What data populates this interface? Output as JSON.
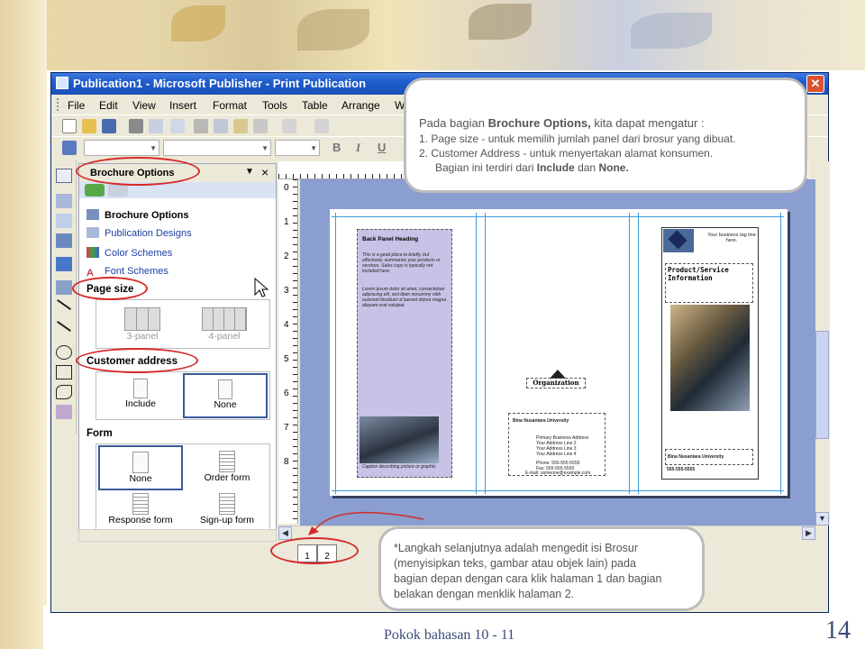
{
  "slide": {
    "footer_text": "Pokok bahasan 10 - 11",
    "page_number": "14"
  },
  "window": {
    "title": "Publication1 - Microsoft Publisher - Print Publication",
    "close_glyph": "✕"
  },
  "menu": {
    "items": [
      "File",
      "Edit",
      "View",
      "Insert",
      "Format",
      "Tools",
      "Table",
      "Arrange",
      "W"
    ]
  },
  "format_toolbar": {
    "bold": "B",
    "italic": "I",
    "underline": "U"
  },
  "task_pane": {
    "title": "Brochure Options",
    "links": [
      {
        "label": "Brochure Options",
        "icon": "brochure-icon"
      },
      {
        "label": "Publication Designs",
        "icon": "designs-icon"
      },
      {
        "label": "Color Schemes",
        "icon": "color-schemes-icon"
      },
      {
        "label": "Font Schemes",
        "icon": "font-schemes-icon"
      }
    ],
    "sections": {
      "page_size": {
        "heading": "Page size",
        "options": [
          "3-panel",
          "4-panel"
        ]
      },
      "customer_address": {
        "heading": "Customer address",
        "options": [
          "Include",
          "None"
        ],
        "selected": "None"
      },
      "form": {
        "heading": "Form",
        "options": [
          "None",
          "Order form",
          "Response form",
          "Sign-up form"
        ],
        "selected": "None"
      }
    }
  },
  "rulers": {
    "vertical_numbers": [
      "0",
      "1",
      "2",
      "3",
      "4",
      "5",
      "6",
      "7",
      "8"
    ]
  },
  "brochure": {
    "back_panel_heading": "Back Panel Heading",
    "back_panel_text": "This is a good place to briefly, but effectively, summarize your products or services. Sales copy is typically not included here.",
    "back_panel_text2": "Lorem ipsum dolor sit amet, consectetuer adipiscing elit, sed diam nonummy nibh euismod tincidunt ut laoreet dolore magna aliquam erat volutpat.",
    "caption": "Caption describing picture or graphic.",
    "organization": "Organization",
    "address_name": "Bina Nusantara University",
    "address_lines": [
      "Primary Business Address",
      "Your Address Line 2",
      "Your Address Line 3",
      "Your Address Line 4"
    ],
    "contact_lines": [
      "Phone: 555-555-5555",
      "Fax: 555-555-5555",
      "E-mail: someone@example.com"
    ],
    "tagline": "Your business tag line here.",
    "product_title": "Product/Service Information",
    "front_org": "Bina Nusantara University",
    "front_phone": "555-555-5555"
  },
  "page_tabs": [
    "1",
    "2"
  ],
  "callout_top": {
    "line1_pre": "Pada bagian ",
    "line1_bold": "Brochure Options,",
    "line1_post": " kita dapat mengatur :",
    "line2": "1. Page size -  untuk memilih jumlah panel dari brosur yang dibuat.",
    "line3": "2. Customer Address - untuk menyertakan alamat konsumen.",
    "line4_pre": "Bagian ini terdiri dari ",
    "line4_b1": "Include",
    "line4_mid": "  dan ",
    "line4_b2": "None."
  },
  "callout_bottom": {
    "line1": "*Langkah selanjutnya adalah mengedit isi Brosur",
    "line2": "(menyisipkan teks, gambar atau objek lain) pada",
    "line3": "bagian depan dengan cara klik halaman 1 dan bagian",
    "line4": "belakan dengan menklik halaman 2."
  },
  "colors": {
    "title_bar": "#1f5ccc",
    "workspace": "#8a9ed0",
    "back_panel": "#c6c3e6",
    "guide": "#3b9ad6",
    "annotation_red": "#d62a2a"
  }
}
